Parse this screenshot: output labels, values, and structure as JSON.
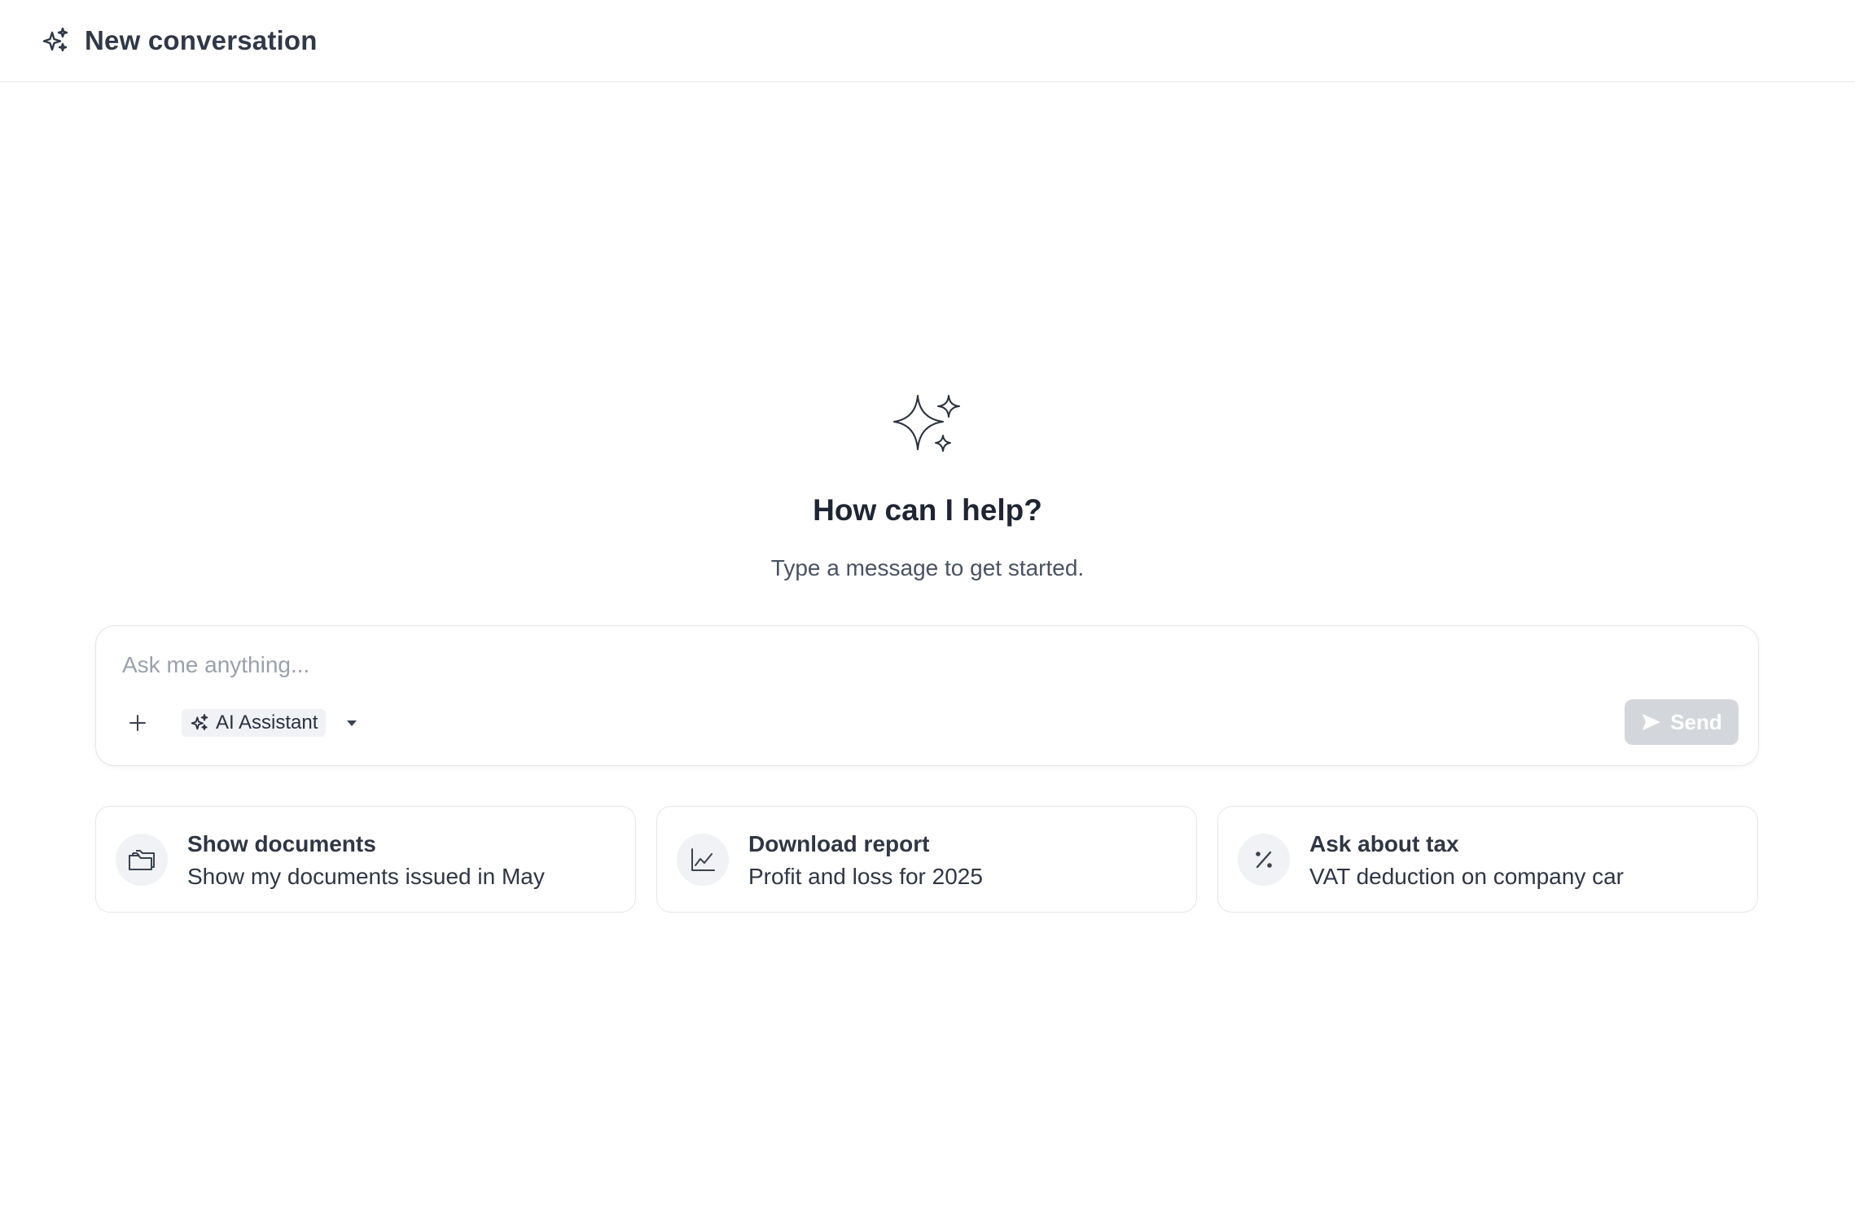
{
  "header": {
    "title": "New conversation",
    "icon": "sparkles-icon"
  },
  "hero": {
    "icon": "sparkles-icon",
    "title": "How can I help?",
    "subtitle": "Type a message to get started."
  },
  "composer": {
    "placeholder": "Ask me anything...",
    "value": "",
    "attach_icon": "plus-icon",
    "model_label": "AI Assistant",
    "model_icon": "sparkles-icon",
    "send_label": "Send",
    "send_icon": "paper-plane-icon"
  },
  "suggestions": [
    {
      "title": "Show documents",
      "description": "Show my documents issued in May",
      "icon": "folders-icon"
    },
    {
      "title": "Download report",
      "description": "Profit and loss for 2025",
      "icon": "line-chart-icon"
    },
    {
      "title": "Ask about tax",
      "description": "VAT deduction on company car",
      "icon": "percent-icon"
    }
  ],
  "colors": {
    "text": "#2f3644",
    "border": "#e4e6ea",
    "send_disabled": "#d3d6db",
    "icon_bg": "#f1f2f5"
  }
}
